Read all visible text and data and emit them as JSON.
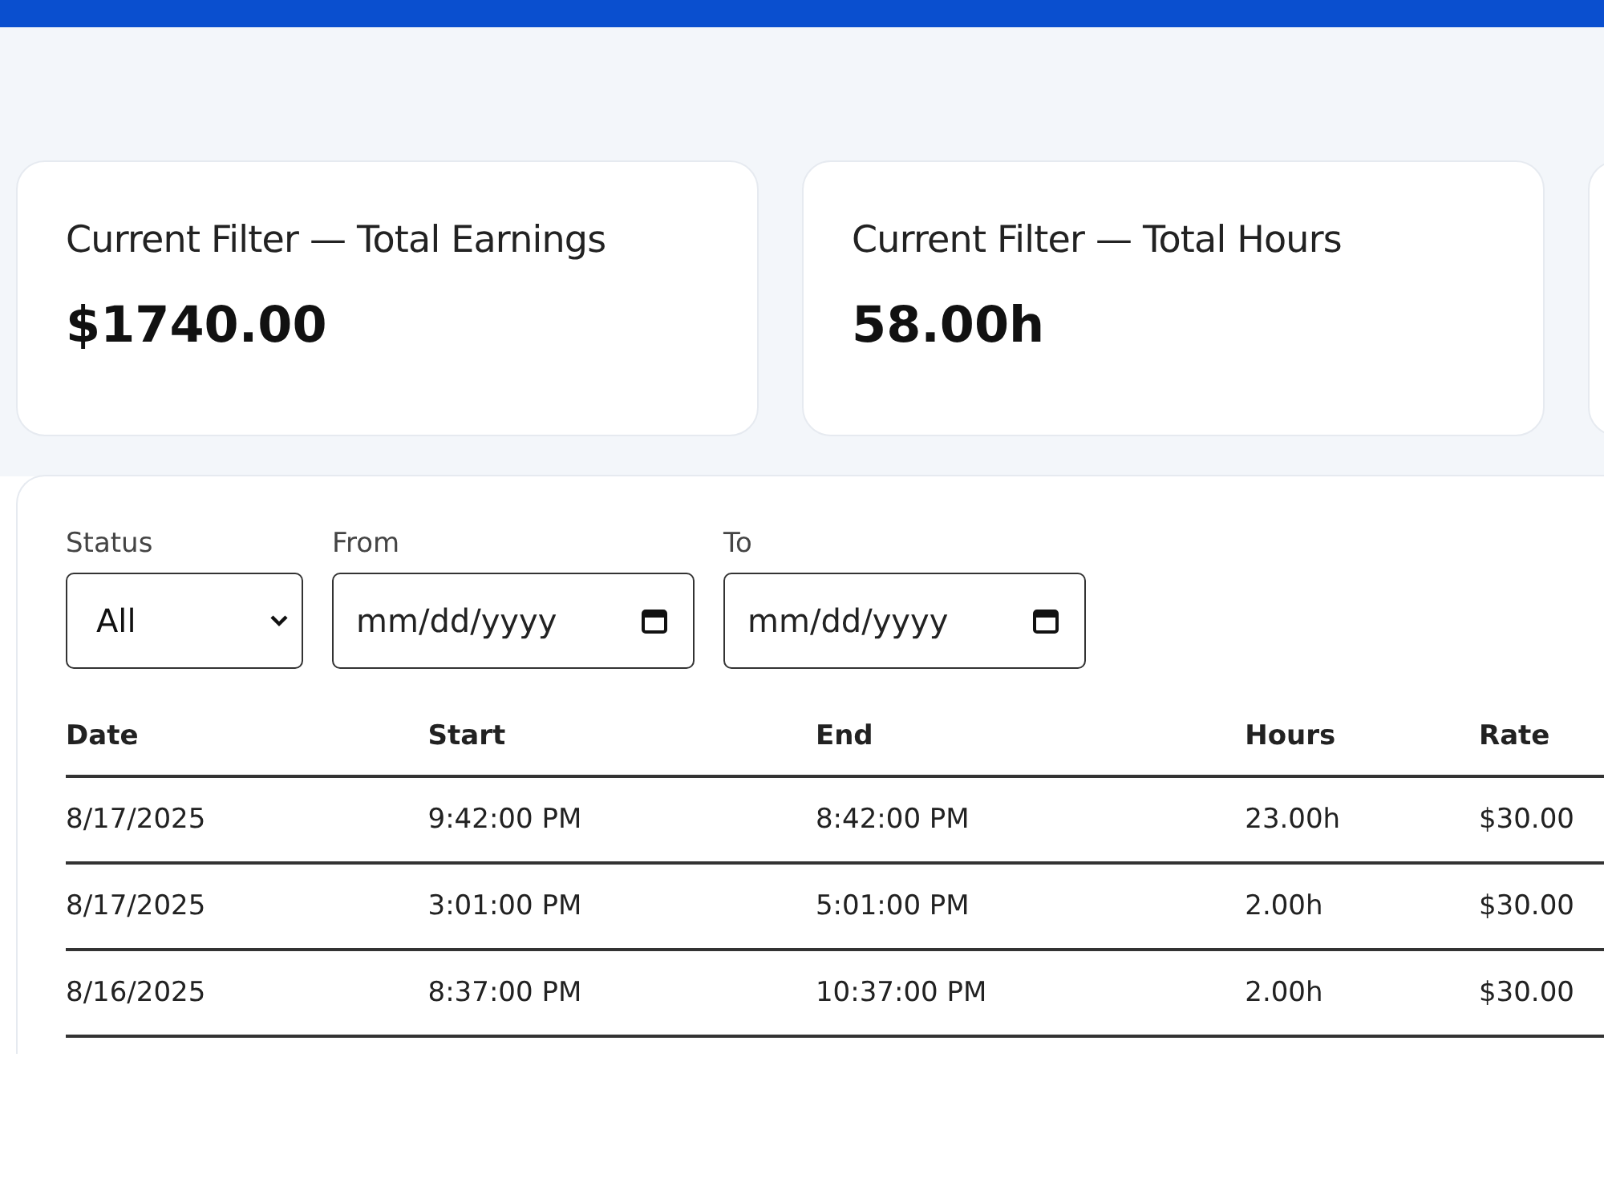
{
  "cards": [
    {
      "label": "Current Filter — Total Earnings",
      "value": "$1740.00"
    },
    {
      "label": "Current Filter — Total Hours",
      "value": "58.00h"
    }
  ],
  "filters": {
    "status": {
      "label": "Status",
      "value": "All"
    },
    "from": {
      "label": "From",
      "placeholder": "mm/dd/yyyy"
    },
    "to": {
      "label": "To",
      "placeholder": "mm/dd/yyyy"
    }
  },
  "table": {
    "columns": [
      "Date",
      "Start",
      "End",
      "Hours",
      "Rate"
    ],
    "rows": [
      [
        "8/17/2025",
        "9:42:00 PM",
        "8:42:00 PM",
        "23.00h",
        "$30.00"
      ],
      [
        "8/17/2025",
        "3:01:00 PM",
        "5:01:00 PM",
        "2.00h",
        "$30.00"
      ],
      [
        "8/16/2025",
        "8:37:00 PM",
        "10:37:00 PM",
        "2.00h",
        "$30.00"
      ]
    ]
  }
}
